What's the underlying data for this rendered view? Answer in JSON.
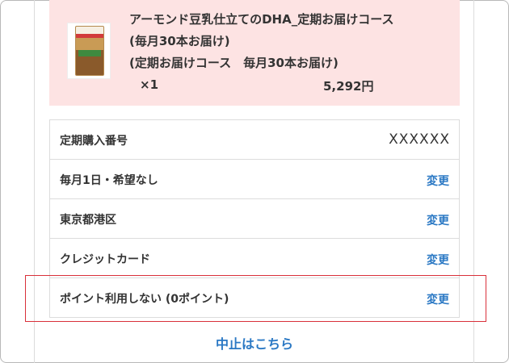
{
  "product": {
    "title": "アーモンド豆乳仕立てのDHA_定期お届けコース",
    "frequency_line1": "(毎月30本お届け)",
    "frequency_line2": "(定期お届けコース　毎月30本お届け)",
    "quantity": "×1",
    "price": "5,292円",
    "image_icon": "product-package-icon"
  },
  "details": {
    "subscription_number_label": "定期購入番号",
    "subscription_number_value": "XXXXXX",
    "delivery_schedule_label": "毎月1日・希望なし",
    "delivery_schedule_change": "変更",
    "address_label": "東京都港区",
    "address_change": "変更",
    "payment_label": "クレジットカード",
    "payment_change": "変更",
    "points_label": "ポイント利用しない (0ポイント)",
    "points_change": "変更"
  },
  "cancel_link": "中止はこちら",
  "colors": {
    "product_background": "#fde3e3",
    "link": "#2a78c4",
    "highlight_border": "#d9303a"
  }
}
